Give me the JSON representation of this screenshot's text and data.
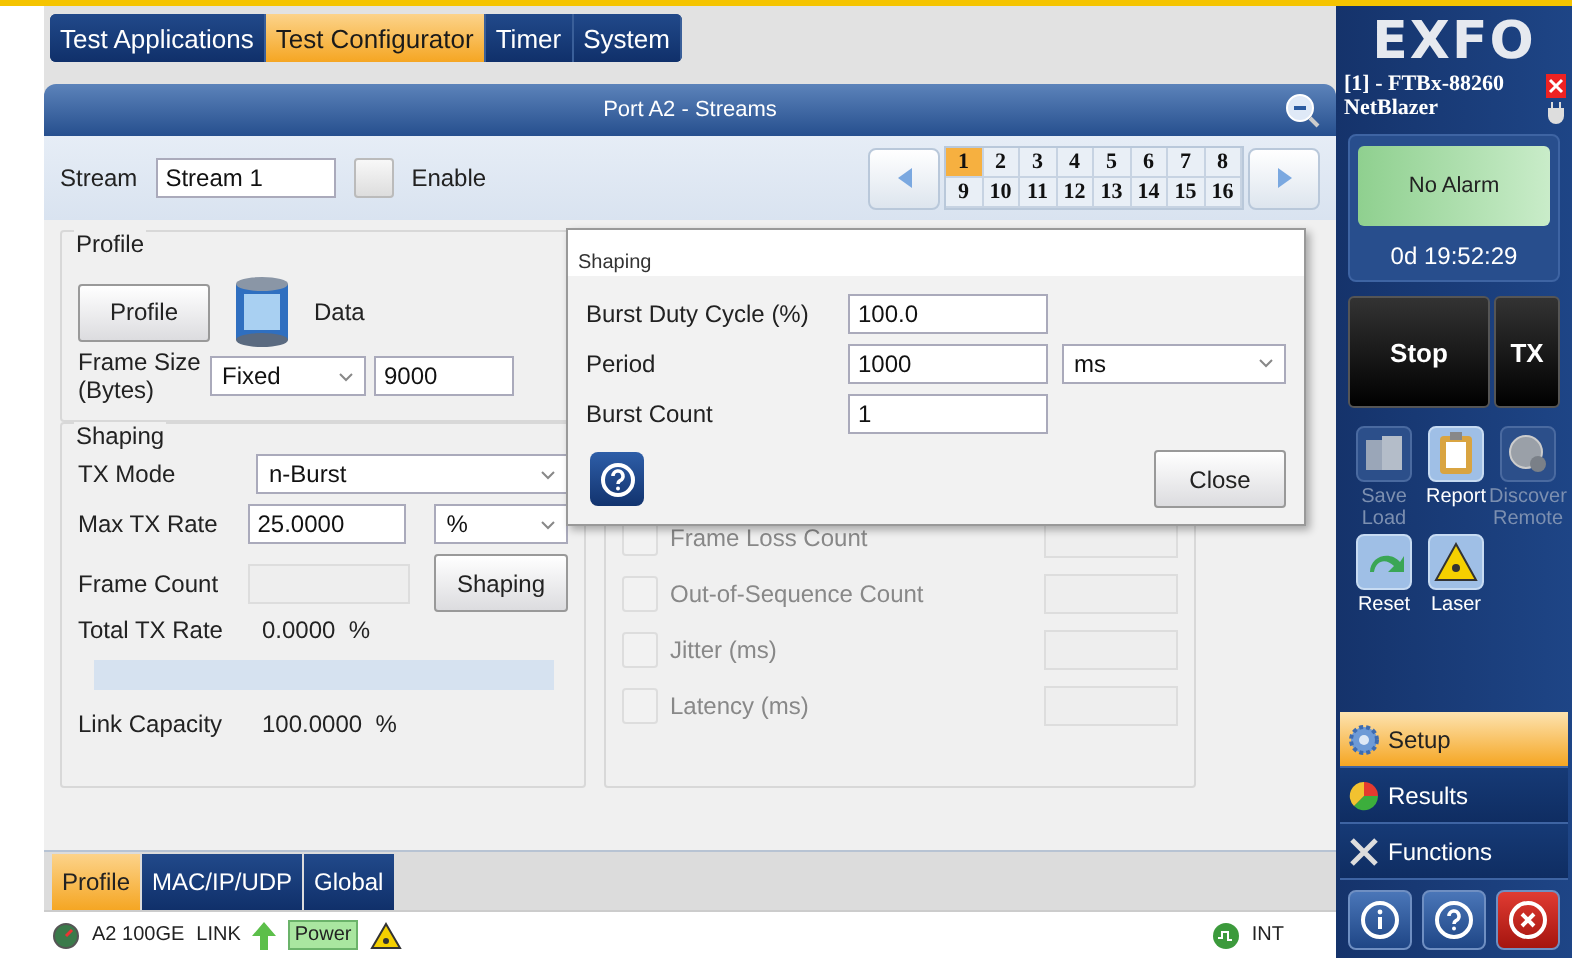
{
  "top_tabs": [
    {
      "label": "Test Applications",
      "selected": false
    },
    {
      "label": "Test Configurator",
      "selected": true
    },
    {
      "label": "Timer",
      "selected": false
    },
    {
      "label": "System",
      "selected": false
    }
  ],
  "panel": {
    "title": "Port A2 - Streams"
  },
  "stream": {
    "label": "Stream",
    "value": "Stream 1",
    "enable_label": "Enable",
    "enabled": false
  },
  "stream_pages": [
    {
      "label": "1",
      "selected": true
    },
    {
      "label": "2",
      "selected": false
    },
    {
      "label": "3",
      "selected": false
    },
    {
      "label": "4",
      "selected": false
    },
    {
      "label": "5",
      "selected": false
    },
    {
      "label": "6",
      "selected": false
    },
    {
      "label": "7",
      "selected": false
    },
    {
      "label": "8",
      "selected": false
    },
    {
      "label": "9",
      "selected": false
    },
    {
      "label": "10",
      "selected": false
    },
    {
      "label": "11",
      "selected": false
    },
    {
      "label": "12",
      "selected": false
    },
    {
      "label": "13",
      "selected": false
    },
    {
      "label": "14",
      "selected": false
    },
    {
      "label": "15",
      "selected": false
    },
    {
      "label": "16",
      "selected": false
    }
  ],
  "profile": {
    "legend": "Profile",
    "button": "Profile",
    "data_label": "Data",
    "frame_size_label": "Frame Size (Bytes)",
    "frame_size_mode": "Fixed",
    "frame_size_value": "9000"
  },
  "shaping": {
    "legend": "Shaping",
    "tx_mode_label": "TX Mode",
    "tx_mode": "n-Burst",
    "max_rate_label": "Max TX Rate",
    "max_rate": "25.0000",
    "max_rate_unit": "%",
    "frame_count_label": "Frame Count",
    "shaping_button": "Shaping",
    "total_label": "Total TX Rate",
    "total_value": "0.0000  %",
    "link_label": "Link Capacity",
    "link_value": "100.0000  %"
  },
  "metrics": [
    {
      "label": "Frame Loss Count",
      "checked": false,
      "disabled": true
    },
    {
      "label": "Out-of-Sequence Count",
      "checked": false,
      "disabled": true
    },
    {
      "label": "Jitter (ms)",
      "checked": false,
      "disabled": true
    },
    {
      "label": "Latency (ms)",
      "checked": false,
      "disabled": true
    }
  ],
  "dialog": {
    "title": "Shaping",
    "rows": [
      {
        "label": "Burst Duty Cycle (%)",
        "value": "100.0"
      },
      {
        "label": "Period",
        "value": "1000",
        "unit": "ms"
      },
      {
        "label": "Burst Count",
        "value": "1"
      }
    ],
    "close": "Close"
  },
  "bottom_tabs": [
    {
      "label": "Profile",
      "selected": true
    },
    {
      "label": "MAC/IP/UDP",
      "selected": false
    },
    {
      "label": "Global",
      "selected": false
    }
  ],
  "status_bar": {
    "port": "A2 100GE",
    "link": "LINK",
    "power": "Power",
    "clock": "INT"
  },
  "sidebar": {
    "logo": "EXFO",
    "device": "[1] - FTBx-88260",
    "model": "NetBlazer",
    "alarm": "No Alarm",
    "elapsed": "0d 19:52:29",
    "stop": "Stop",
    "tx": "TX",
    "tools": [
      {
        "kind": "save",
        "label": "Save Load",
        "disabled": true
      },
      {
        "kind": "report",
        "label": "Report",
        "disabled": false
      },
      {
        "kind": "discover",
        "label": "Discover Remote",
        "disabled": true
      },
      {
        "kind": "reset",
        "label": "Reset",
        "disabled": false
      },
      {
        "kind": "laser",
        "label": "Laser",
        "disabled": false
      }
    ],
    "nav": [
      {
        "kind": "setup",
        "label": "Setup",
        "selected": true
      },
      {
        "kind": "results",
        "label": "Results",
        "selected": false
      },
      {
        "kind": "functions",
        "label": "Functions",
        "selected": false
      }
    ]
  }
}
